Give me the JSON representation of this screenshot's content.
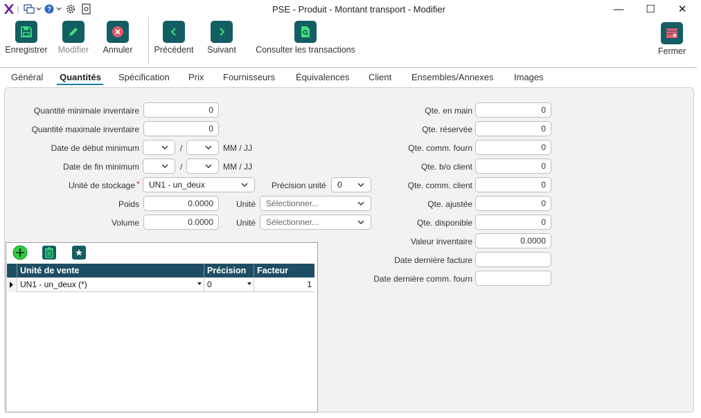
{
  "window": {
    "title": "PSE - Produit - Montant transport - Modifier",
    "minimize_glyph": "—",
    "maximize_glyph": "☐",
    "close_glyph": "✕"
  },
  "toolbar": {
    "save": "Enregistrer",
    "modify": "Modifier",
    "cancel": "Annuler",
    "previous": "Précédent",
    "next": "Suivant",
    "transactions": "Consulter les transactions",
    "close": "Fermer"
  },
  "tabs": [
    "Général",
    "Quantités",
    "Spécification",
    "Prix",
    "Fournisseurs",
    "Équivalences",
    "Client",
    "Ensembles/Annexes",
    "Images"
  ],
  "active_tab": "Quantités",
  "form": {
    "qty_min_label": "Quantité minimale inventaire",
    "qty_min_value": "0",
    "qty_max_label": "Quantité maximale inventaire",
    "qty_max_value": "0",
    "date_start_label": "Date de début minimum",
    "date_end_label": "Date de fin minimum",
    "date_sep": "/",
    "date_format": "MM / JJ",
    "storage_unit_label": "Unité de stockage",
    "required_mark": "*",
    "storage_unit_value": "UN1 - un_deux",
    "precision_label": "Précision unité",
    "precision_value": "0",
    "weight_label": "Poids",
    "weight_value": "0.0000",
    "volume_label": "Volume",
    "volume_value": "0.0000",
    "unit_label": "Unité",
    "unit_placeholder": "Sélectionner..."
  },
  "stock": {
    "on_hand_label": "Qte. en main",
    "on_hand": "0",
    "reserved_label": "Qte. réservée",
    "reserved": "0",
    "ordered_supplier_label": "Qte. comm. fourn",
    "ordered_supplier": "0",
    "backorder_label": "Qte. b/o client",
    "backorder": "0",
    "ordered_client_label": "Qte. comm. client",
    "ordered_client": "0",
    "adjusted_label": "Qte. ajustée",
    "adjusted": "0",
    "available_label": "Qte. disponible",
    "available": "0",
    "inventory_value_label": "Valeur inventaire",
    "inventory_value": "0.0000",
    "last_invoice_label": "Date dernière facture",
    "last_invoice": "",
    "last_supplier_order_label": "Date dernière comm. fourn",
    "last_supplier_order": ""
  },
  "grid": {
    "columns": [
      "Unité de vente",
      "Précision",
      "Facteur"
    ],
    "rows": [
      {
        "unit": "UN1 - un_deux (*)",
        "precision": "0",
        "factor": "1"
      }
    ]
  },
  "colors": {
    "accent": "#135e63",
    "tab_underline": "#1a7ab0",
    "grid_header": "#1d4e63",
    "add_button": "#2ecc40",
    "required": "#c62828"
  }
}
